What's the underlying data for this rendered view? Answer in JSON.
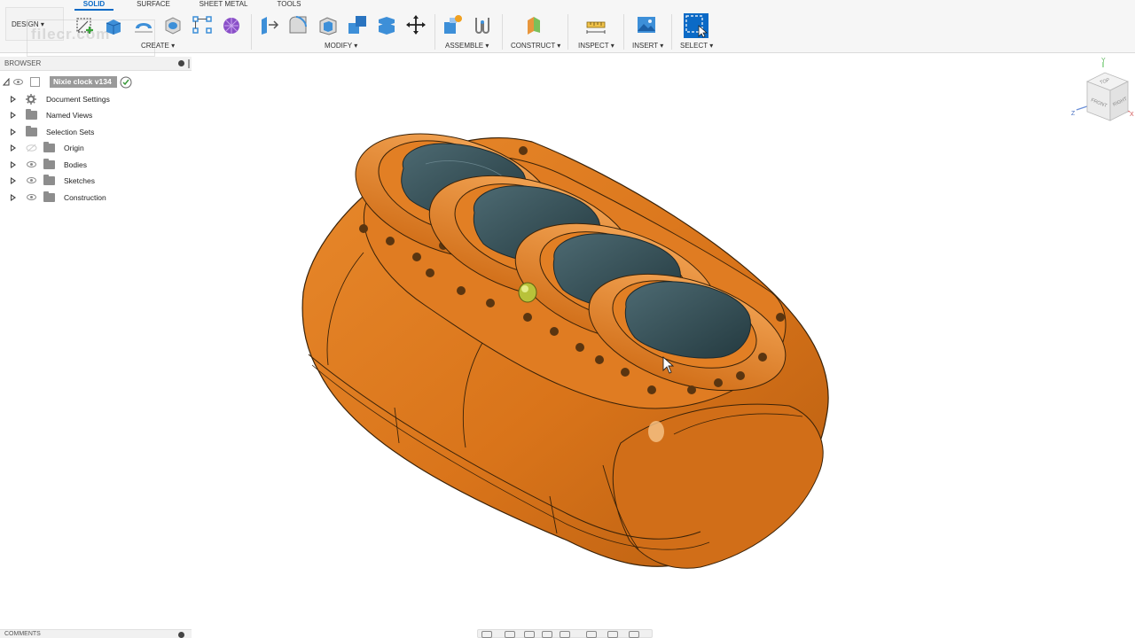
{
  "tabs": [
    {
      "label": "SOLID",
      "active": true
    },
    {
      "label": "SURFACE",
      "active": false
    },
    {
      "label": "SHEET METAL",
      "active": false
    },
    {
      "label": "TOOLS",
      "active": false
    }
  ],
  "workspace": {
    "label": "DESIGN ▾"
  },
  "watermark": {
    "text": "filecr.com"
  },
  "toolbar_groups": [
    {
      "label": "CREATE ▾"
    },
    {
      "label": "MODIFY ▾"
    },
    {
      "label": "ASSEMBLE ▾"
    },
    {
      "label": "CONSTRUCT ▾"
    },
    {
      "label": "INSPECT ▾"
    },
    {
      "label": "INSERT ▾"
    },
    {
      "label": "SELECT ▾"
    }
  ],
  "browser": {
    "title": "BROWSER",
    "root": "Nixie clock v134",
    "items": [
      {
        "label": "Document Settings",
        "icon": "gear-icon"
      },
      {
        "label": "Named Views",
        "icon": "folder-icon"
      },
      {
        "label": "Selection Sets",
        "icon": "folder-icon"
      },
      {
        "label": "Origin",
        "icon": "folder-icon",
        "eye": "hidden"
      },
      {
        "label": "Bodies",
        "icon": "folder-icon",
        "eye": "visible"
      },
      {
        "label": "Sketches",
        "icon": "folder-icon",
        "eye": "visible"
      },
      {
        "label": "Construction",
        "icon": "folder-icon",
        "eye": "visible"
      }
    ]
  },
  "comments": {
    "title": "COMMENTS"
  },
  "viewcube": {
    "top": "TOP",
    "front": "FRONT",
    "right": "RIGHT",
    "axis_x": "X",
    "axis_y": "Y",
    "axis_z": "Z"
  },
  "colors": {
    "accent": "#0b6ac6",
    "body": "#e07a1e",
    "glass": "#2f4a52"
  }
}
